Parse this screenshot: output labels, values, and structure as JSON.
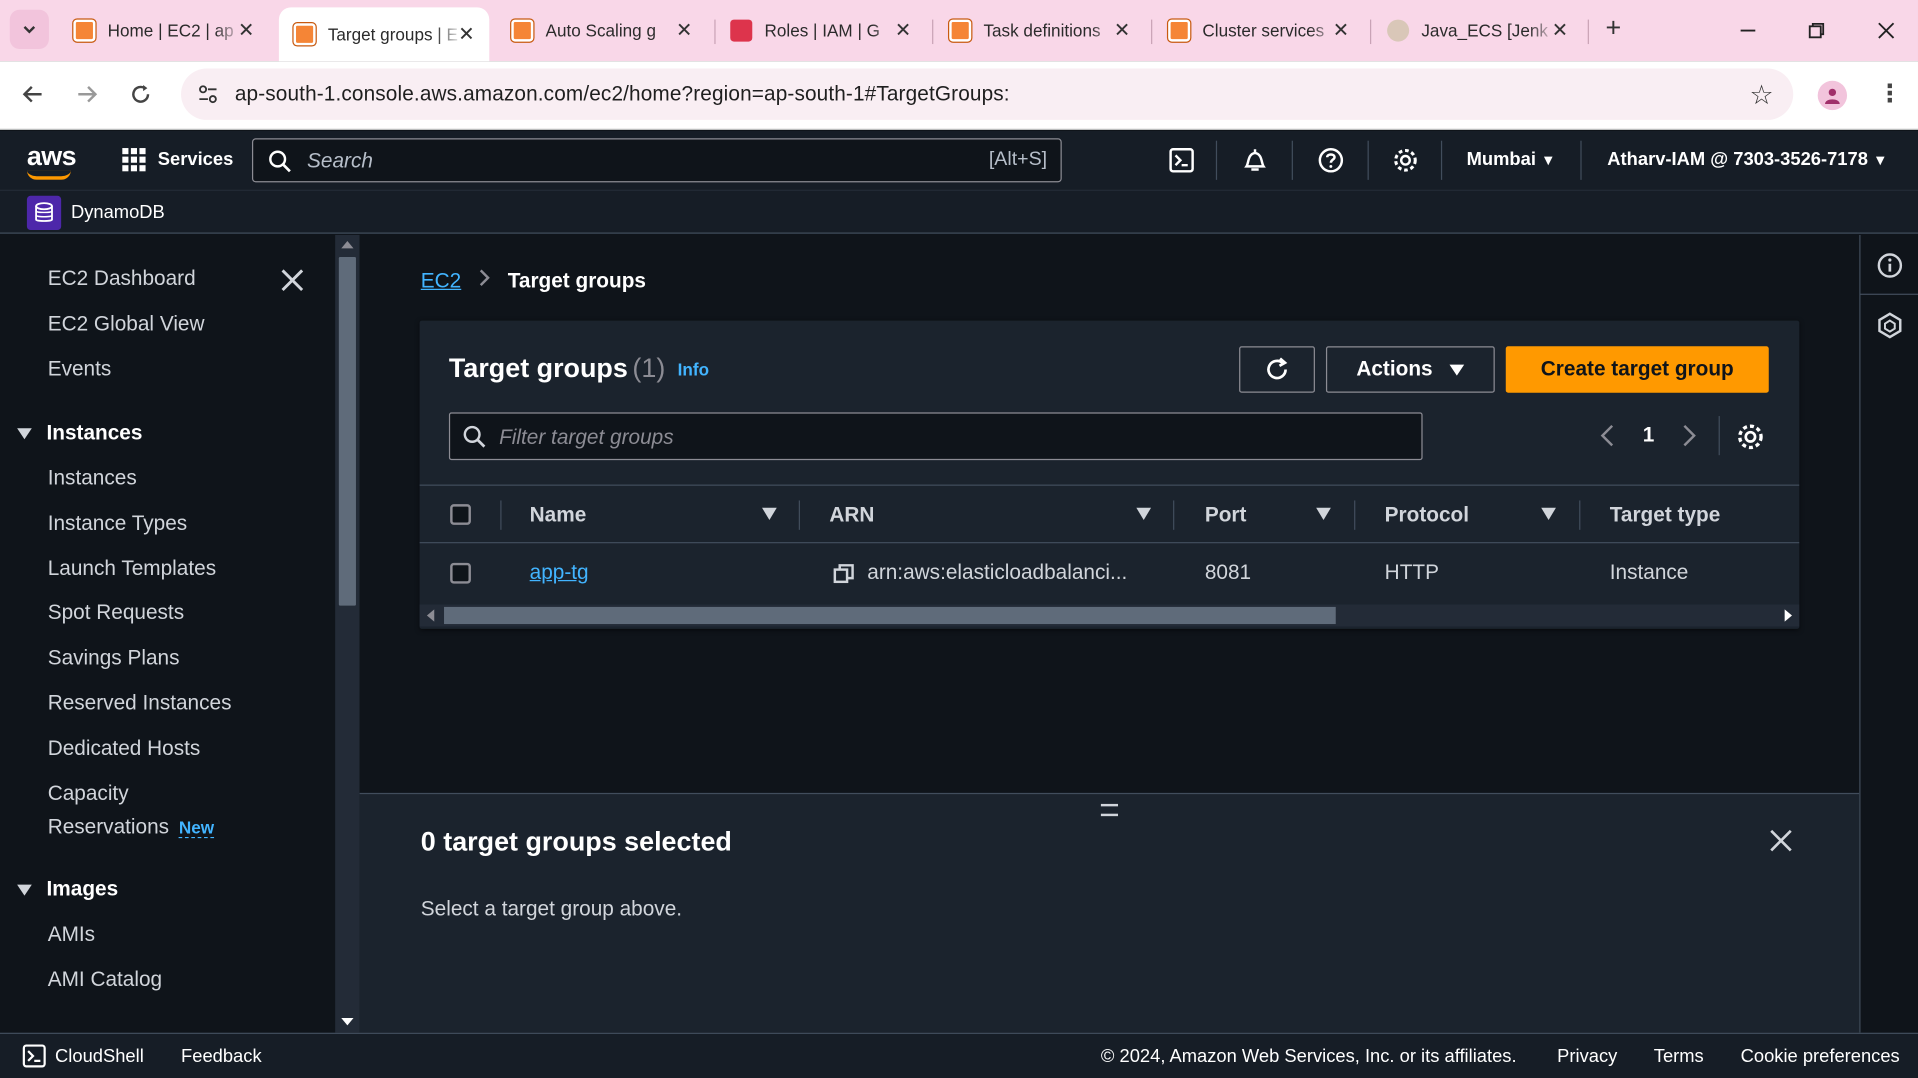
{
  "browser": {
    "tabs": [
      {
        "title": "Home | EC2 | ap",
        "favicon": "aws-orange",
        "active": false
      },
      {
        "title": "Target groups | E",
        "favicon": "aws-orange",
        "active": true
      },
      {
        "title": "Auto Scaling g",
        "favicon": "aws-orange",
        "active": false
      },
      {
        "title": "Roles | IAM | G",
        "favicon": "aws-red",
        "active": false
      },
      {
        "title": "Task definitions",
        "favicon": "aws-orange",
        "active": false
      },
      {
        "title": "Cluster services",
        "favicon": "aws-orange",
        "active": false
      },
      {
        "title": "Java_ECS [Jenk",
        "favicon": "jenkins-avatar",
        "active": false
      }
    ],
    "url": "ap-south-1.console.aws.amazon.com/ec2/home?region=ap-south-1#TargetGroups:"
  },
  "aws_nav": {
    "logo": "aws",
    "services_label": "Services",
    "search_placeholder": "Search",
    "search_shortcut": "[Alt+S]",
    "region": "Mumbai",
    "account": "Atharv-IAM @ 7303-3526-7178",
    "favorite": "DynamoDB"
  },
  "sidebar": {
    "items_top": [
      "EC2 Dashboard",
      "EC2 Global View",
      "Events"
    ],
    "section_instances": "Instances",
    "instances_items": [
      "Instances",
      "Instance Types",
      "Launch Templates",
      "Spot Requests",
      "Savings Plans",
      "Reserved Instances",
      "Dedicated Hosts"
    ],
    "capacity_line1": "Capacity",
    "capacity_line2": "Reservations",
    "new_badge": "New",
    "section_images": "Images",
    "images_items": [
      "AMIs",
      "AMI Catalog"
    ]
  },
  "main": {
    "breadcrumb": {
      "root": "EC2",
      "current": "Target groups"
    },
    "panel": {
      "title": "Target groups",
      "count": "(1)",
      "info": "Info",
      "actions_label": "Actions",
      "create_label": "Create target group",
      "filter_placeholder": "Filter target groups",
      "page": "1"
    },
    "table": {
      "columns": [
        "Name",
        "ARN",
        "Port",
        "Protocol",
        "Target type"
      ],
      "rows": [
        {
          "name": "app-tg",
          "arn": "arn:aws:elasticloadbalanci...",
          "port": "8081",
          "protocol": "HTTP",
          "target_type": "Instance"
        }
      ]
    }
  },
  "split_panel": {
    "title": "0 target groups selected",
    "message": "Select a target group above."
  },
  "footer": {
    "cloudshell": "CloudShell",
    "feedback": "Feedback",
    "copyright": "© 2024, Amazon Web Services, Inc. or its affiliates.",
    "privacy": "Privacy",
    "terms": "Terms",
    "cookies": "Cookie preferences"
  },
  "colors": {
    "accent_orange": "#ff9900",
    "link_blue": "#42b4ff",
    "nav_bg": "#161d26",
    "page_bg": "#0f141a",
    "tabstrip_bg": "#f9d7e8"
  }
}
